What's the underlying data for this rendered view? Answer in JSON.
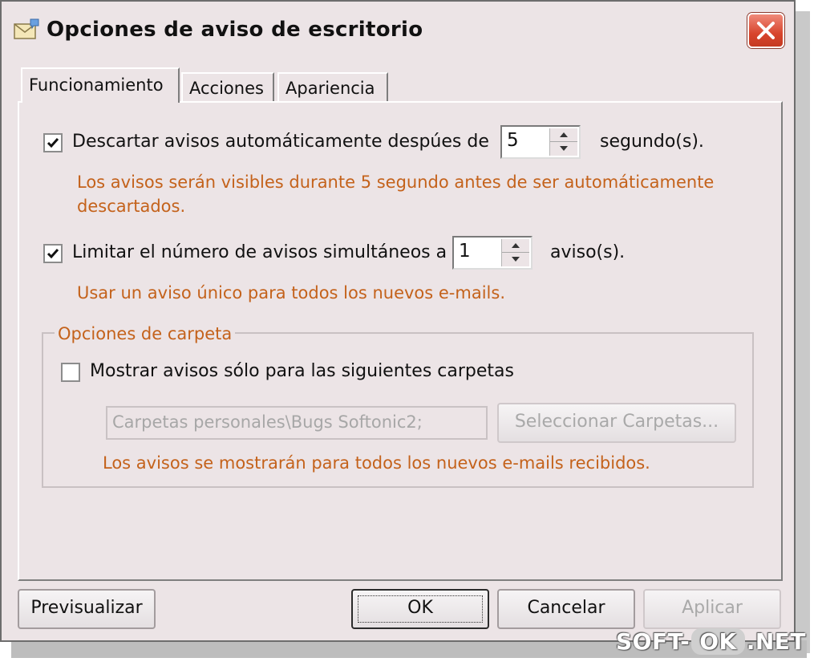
{
  "window": {
    "title": "Opciones de aviso de escritorio",
    "icon": "envelope-notice-icon",
    "close_icon": "close-icon"
  },
  "tabs": [
    {
      "label": "Funcionamiento",
      "active": true
    },
    {
      "label": "Acciones",
      "active": false
    },
    {
      "label": "Apariencia",
      "active": false
    }
  ],
  "dismiss": {
    "checked": true,
    "label": "Descartar avisos automáticamente despúes de",
    "value": "5",
    "unit": "segundo(s).",
    "note_line1": "Los avisos serán visibles durante 5 segundo antes de ser automáticamente",
    "note_line2": "descartados."
  },
  "limit": {
    "checked": true,
    "label": "Limitar el número de avisos simultáneos a",
    "value": "1",
    "unit": "aviso(s).",
    "note": "Usar un aviso único para todos los nuevos e-mails."
  },
  "folders": {
    "legend": "Opciones de carpeta",
    "checked": false,
    "label": "Mostrar avisos sólo para las siguientes carpetas",
    "path_value": "Carpetas personales\\Bugs Softonic2;",
    "select_button": "Seleccionar Carpetas...",
    "note": "Los avisos se mostrarán para todos los nuevos e-mails recibidos."
  },
  "buttons": {
    "preview": "Previsualizar",
    "ok": "OK",
    "cancel": "Cancelar",
    "apply": "Aplicar"
  },
  "watermark": {
    "left": "SOFT-",
    "mid": "OK",
    "right": ".NET"
  },
  "colors": {
    "dialog_bg": "#ece4e6",
    "note_text": "#c4621b",
    "close_button": "#d8452d"
  }
}
